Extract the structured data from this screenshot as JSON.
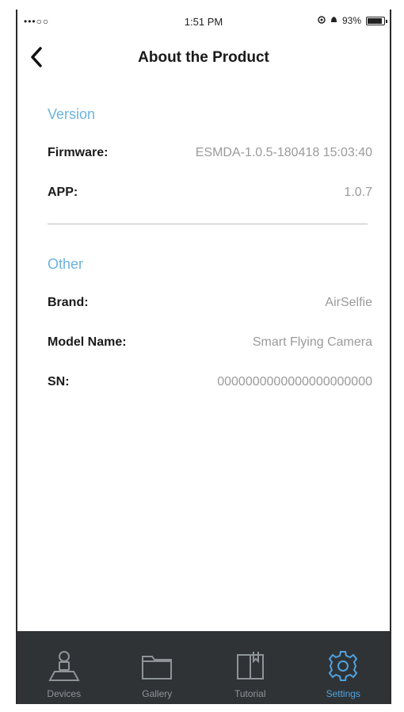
{
  "status": {
    "signal": "•••○○",
    "time": "1:51 PM",
    "battery_text": "93%",
    "battery_level": 0.93
  },
  "nav": {
    "title": "About the Product"
  },
  "version": {
    "header": "Version",
    "rows": [
      {
        "label": "Firmware:",
        "value": "ESMDA-1.0.5-180418 15:03:40"
      },
      {
        "label": "APP:",
        "value": "1.0.7"
      }
    ]
  },
  "other": {
    "header": "Other",
    "rows": [
      {
        "label": "Brand:",
        "value": "AirSelfie"
      },
      {
        "label": "Model Name:",
        "value": "Smart Flying Camera"
      },
      {
        "label": "SN:",
        "value": "0000000000000000000000"
      }
    ]
  },
  "tabs": [
    {
      "label": "Devices",
      "icon": "devices-icon"
    },
    {
      "label": "Gallery",
      "icon": "gallery-icon"
    },
    {
      "label": "Tutorial",
      "icon": "tutorial-icon"
    },
    {
      "label": "Settings",
      "icon": "settings-icon",
      "active": true
    }
  ],
  "colors": {
    "accent": "#4fa3e0",
    "section_header": "#6cb3e0",
    "tabbar_bg": "#2f3336",
    "tab_inactive": "#8f9498"
  }
}
